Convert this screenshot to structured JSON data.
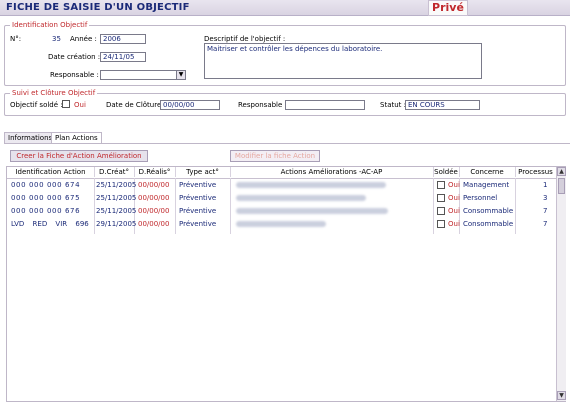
{
  "header": {
    "title": "FICHE DE SAISIE D'UN OBJECTIF",
    "badge": "Privé"
  },
  "identification": {
    "legend": "Identification Objectif",
    "no_label": "N°:",
    "no_value": "35",
    "annee_label": "Année :",
    "annee_value": "2006",
    "date_creation_label": "Date création :",
    "date_creation_value": "24/11/05",
    "responsable_label": "Responsable :",
    "responsable_value": "",
    "descriptif_label": "Descriptif de l'objectif :",
    "descriptif_value": "Maitriser et contrôler les dépences du laboratoire."
  },
  "suivi": {
    "legend": "Suivi et Clôture Objectif",
    "solde_label": "Objectif soldé :",
    "solde_oui": "Oui",
    "cloture_label": "Date de Clôture:",
    "cloture_value": "00/00/00",
    "responsable_label": "Responsable :",
    "responsable_value": "",
    "statut_label": "Statut :",
    "statut_value": "EN COURS"
  },
  "tabs": [
    "Informations",
    "Plan Actions"
  ],
  "buttons": {
    "create": "Creer la Fiche d'Action Amélioration",
    "modify": "Modifier la fiche Action"
  },
  "table": {
    "headers": [
      "Identification Action",
      "D.Créat°",
      "D.Réalis°",
      "Type act°",
      "Actions Améliorations -AC-AP",
      "Soldée",
      "Concerne",
      "Processus"
    ],
    "rows": [
      {
        "id": "000 000 000 674",
        "dcreat": "25/11/2005",
        "dreal": "00/00/00",
        "type": "Préventive",
        "solde": "Oui",
        "concerne": "Management",
        "processus": "1"
      },
      {
        "id": "000 000 000 675",
        "dcreat": "25/11/2005",
        "dreal": "00/00/00",
        "type": "Préventive",
        "solde": "Oui",
        "concerne": "Personnel",
        "processus": "3"
      },
      {
        "id": "000 000 000 676",
        "dcreat": "25/11/2005",
        "dreal": "00/00/00",
        "type": "Préventive",
        "solde": "Oui",
        "concerne": "Consommable",
        "processus": "7"
      },
      {
        "id": "LVD RED VIR 696",
        "dcreat": "29/11/2005",
        "dreal": "00/00/00",
        "type": "Préventive",
        "solde": "Oui",
        "concerne": "Consommable",
        "processus": "7"
      }
    ]
  },
  "colors": {
    "accent_red": "#c0282c",
    "text_blue": "#1b2a78",
    "header_bg": "#e1dbe8"
  }
}
